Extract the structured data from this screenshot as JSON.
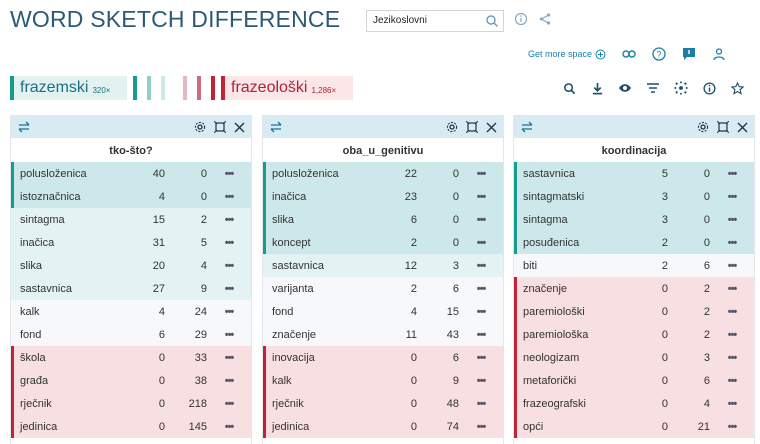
{
  "header": {
    "title": "WORD SKETCH DIFFERENCE"
  },
  "search": {
    "value": "Jezikoslovni"
  },
  "toolbar": {
    "get_more_space": "Get more space"
  },
  "legend": {
    "term_a": {
      "label": "frazemski",
      "count": "320×"
    },
    "term_b": {
      "label": "frazeološki",
      "count": "1,286×"
    },
    "bars": [
      "#169c8d",
      "#8fcfc7",
      "#cfe9e5",
      "#e5b8c0",
      "#d06a7d",
      "#c0233a"
    ]
  },
  "colors": {
    "a_strong": "#cde8ea",
    "a_light": "#e3f2f3",
    "neutral": "#f7f8f9",
    "b_light": "#f7dfe2",
    "a_border": "#169c8d",
    "b_border": "#c0233a"
  },
  "panels": [
    {
      "title": "tko-što?",
      "rows": [
        {
          "word": "polusloženica",
          "a": "40",
          "b": "0",
          "tone": "a_strong",
          "border": "a"
        },
        {
          "word": "istoznačnica",
          "a": "4",
          "b": "0",
          "tone": "a_strong",
          "border": "a"
        },
        {
          "word": "sintagma",
          "a": "15",
          "b": "2",
          "tone": "a_light",
          "border": ""
        },
        {
          "word": "inačica",
          "a": "31",
          "b": "5",
          "tone": "a_light",
          "border": ""
        },
        {
          "word": "slika",
          "a": "20",
          "b": "4",
          "tone": "a_light",
          "border": ""
        },
        {
          "word": "sastavnica",
          "a": "27",
          "b": "9",
          "tone": "a_light",
          "border": ""
        },
        {
          "word": "kalk",
          "a": "4",
          "b": "24",
          "tone": "neutral",
          "border": ""
        },
        {
          "word": "fond",
          "a": "6",
          "b": "29",
          "tone": "neutral",
          "border": ""
        },
        {
          "word": "škola",
          "a": "0",
          "b": "33",
          "tone": "b_light",
          "border": "b"
        },
        {
          "word": "građa",
          "a": "0",
          "b": "38",
          "tone": "b_light",
          "border": "b"
        },
        {
          "word": "rječnik",
          "a": "0",
          "b": "218",
          "tone": "b_light",
          "border": "b"
        },
        {
          "word": "jedinica",
          "a": "0",
          "b": "145",
          "tone": "b_light",
          "border": "b"
        }
      ]
    },
    {
      "title": "oba_u_genitivu",
      "rows": [
        {
          "word": "polusloženica",
          "a": "22",
          "b": "0",
          "tone": "a_strong",
          "border": "a"
        },
        {
          "word": "inačica",
          "a": "23",
          "b": "0",
          "tone": "a_strong",
          "border": "a"
        },
        {
          "word": "slika",
          "a": "6",
          "b": "0",
          "tone": "a_strong",
          "border": "a"
        },
        {
          "word": "koncept",
          "a": "2",
          "b": "0",
          "tone": "a_strong",
          "border": "a"
        },
        {
          "word": "sastavnica",
          "a": "12",
          "b": "3",
          "tone": "a_light",
          "border": ""
        },
        {
          "word": "varijanta",
          "a": "2",
          "b": "6",
          "tone": "neutral",
          "border": ""
        },
        {
          "word": "fond",
          "a": "4",
          "b": "15",
          "tone": "neutral",
          "border": ""
        },
        {
          "word": "značenje",
          "a": "11",
          "b": "43",
          "tone": "neutral",
          "border": ""
        },
        {
          "word": "inovacija",
          "a": "0",
          "b": "6",
          "tone": "b_light",
          "border": "b"
        },
        {
          "word": "kalk",
          "a": "0",
          "b": "9",
          "tone": "b_light",
          "border": "b"
        },
        {
          "word": "rječnik",
          "a": "0",
          "b": "48",
          "tone": "b_light",
          "border": "b"
        },
        {
          "word": "jedinica",
          "a": "0",
          "b": "74",
          "tone": "b_light",
          "border": "b"
        }
      ]
    },
    {
      "title": "koordinacija",
      "rows": [
        {
          "word": "sastavnica",
          "a": "5",
          "b": "0",
          "tone": "a_strong",
          "border": "a"
        },
        {
          "word": "sintagmatski",
          "a": "3",
          "b": "0",
          "tone": "a_strong",
          "border": "a"
        },
        {
          "word": "sintagma",
          "a": "3",
          "b": "0",
          "tone": "a_strong",
          "border": "a"
        },
        {
          "word": "posuđenica",
          "a": "2",
          "b": "0",
          "tone": "a_strong",
          "border": "a"
        },
        {
          "word": "biti",
          "a": "2",
          "b": "6",
          "tone": "neutral",
          "border": ""
        },
        {
          "word": "značenje",
          "a": "0",
          "b": "2",
          "tone": "b_light",
          "border": "b"
        },
        {
          "word": "paremiološki",
          "a": "0",
          "b": "2",
          "tone": "b_light",
          "border": "b"
        },
        {
          "word": "paremiološka",
          "a": "0",
          "b": "2",
          "tone": "b_light",
          "border": "b"
        },
        {
          "word": "neologizam",
          "a": "0",
          "b": "3",
          "tone": "b_light",
          "border": "b"
        },
        {
          "word": "metaforički",
          "a": "0",
          "b": "6",
          "tone": "b_light",
          "border": "b"
        },
        {
          "word": "frazeografski",
          "a": "0",
          "b": "4",
          "tone": "b_light",
          "border": "b"
        },
        {
          "word": "opći",
          "a": "0",
          "b": "21",
          "tone": "b_light",
          "border": "b"
        }
      ]
    }
  ]
}
